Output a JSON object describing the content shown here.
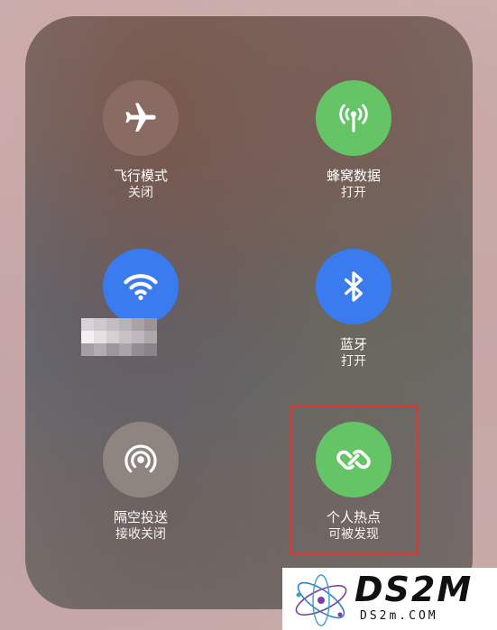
{
  "control_center": {
    "airplane": {
      "label": "飞行模式",
      "status": "关闭",
      "color": "#8a6b63"
    },
    "cellular": {
      "label": "蜂窝数据",
      "status": "打开",
      "color": "#65c466"
    },
    "wifi": {
      "label": "",
      "status": "",
      "color": "#3a7bf0"
    },
    "bluetooth": {
      "label": "蓝牙",
      "status": "打开",
      "color": "#3a7bf0"
    },
    "airdrop": {
      "label": "隔空投送",
      "status": "接收关闭",
      "color": "#8f8580"
    },
    "hotspot": {
      "label": "个人热点",
      "status": "可被发现",
      "color": "#65c466"
    }
  },
  "highlight_color": "#e8322f",
  "watermark": {
    "logo_text": "DS2M",
    "site_text": "DS2m.COM"
  }
}
